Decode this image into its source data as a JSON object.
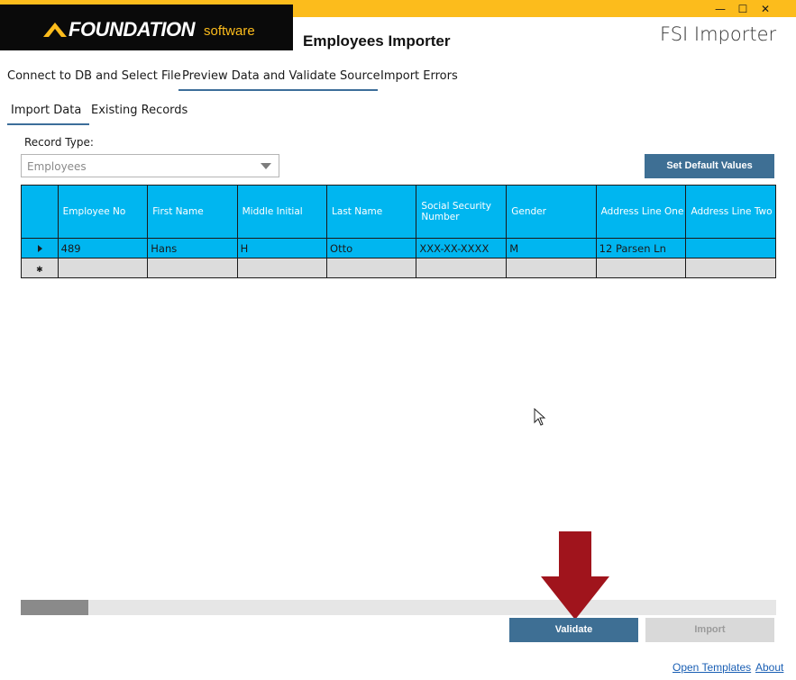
{
  "window": {
    "minimize_glyph": "—",
    "maximize_glyph": "☐",
    "close_glyph": "✕"
  },
  "brand": {
    "logo_text": "FOUNDATION",
    "logo_sub": "software",
    "accent_color": "#fcbc1c"
  },
  "header": {
    "title": "Employees Importer",
    "app_name": "FSI Importer"
  },
  "tabs": [
    {
      "label": "Connect to DB and Select File"
    },
    {
      "label": "Preview Data and Validate Source",
      "active": true
    },
    {
      "label": "Import Errors"
    }
  ],
  "subtabs": [
    {
      "label": "Import Data",
      "active": true
    },
    {
      "label": "Existing Records"
    }
  ],
  "record_type": {
    "label": "Record Type:",
    "value": "Employees"
  },
  "buttons": {
    "set_default": "Set Default Values",
    "validate": "Validate",
    "import": "Import"
  },
  "grid": {
    "columns": [
      "Employee No",
      "First Name",
      "Middle Initial",
      "Last Name",
      "Social Security Number",
      "Gender",
      "Address Line One",
      "Address Line Two"
    ],
    "rows": [
      [
        "489",
        "Hans",
        "H",
        "Otto",
        "XXX-XX-XXXX",
        "M",
        "12 Parsen Ln",
        ""
      ]
    ],
    "new_row_marker": "✱"
  },
  "scrollbar": {
    "position_fraction": 0.0
  },
  "footer": {
    "open_templates": "Open Templates",
    "about": "About"
  },
  "colors": {
    "grid_header": "#00b6f0",
    "button_primary": "#3e6f94",
    "tab_underline": "#3d6e9a",
    "annotation_arrow": "#a0141c"
  }
}
